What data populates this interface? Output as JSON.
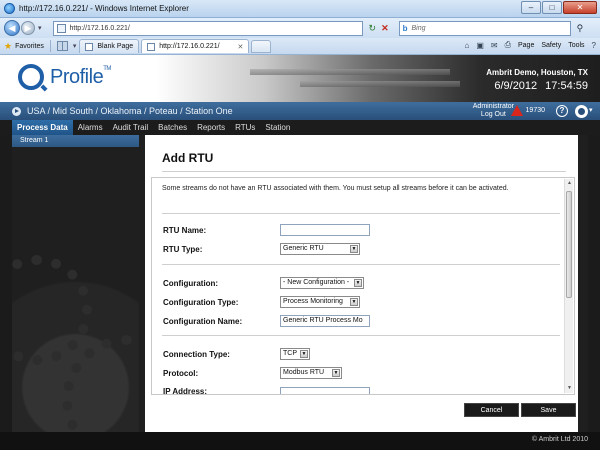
{
  "browser": {
    "title": "http://172.16.0.221/ - Windows Internet Explorer",
    "url": "http://172.16.0.221/",
    "search_placeholder": "Bing",
    "favorites_label": "Favorites",
    "tabs": [
      {
        "label": "Blank Page"
      },
      {
        "label": "http://172.16.0.221/"
      }
    ],
    "commands": [
      "Page",
      "Safety",
      "Tools"
    ]
  },
  "header": {
    "logo_text": "Profile",
    "logo_tm": "TM",
    "site": "Ambrit Demo, Houston, TX",
    "date": "6/9/2012",
    "time": "17:54:59"
  },
  "breadcrumb": "USA / Mid South / Oklahoma / Poteau / Station One",
  "user": {
    "line1": "Administrator",
    "line2": "Log Out"
  },
  "alert_count": "19730",
  "nav": [
    "Process Data",
    "Alarms",
    "Audit Trail",
    "Batches",
    "Reports",
    "RTUs",
    "Station"
  ],
  "sidebar": {
    "items": [
      "Stream 1"
    ]
  },
  "form": {
    "title": "Add RTU",
    "notice": "Some streams do not have an RTU associated with them. You must setup all streams before it can be activated.",
    "rtu_name_label": "RTU Name:",
    "rtu_name_value": "",
    "rtu_type_label": "RTU Type:",
    "rtu_type_value": "Generic RTU",
    "configuration_label": "Configuration:",
    "configuration_value": "- New Configuration -",
    "configuration_type_label": "Configuration Type:",
    "configuration_type_value": "Process Monitoring",
    "configuration_name_label": "Configuration Name:",
    "configuration_name_value": "Generic RTU Process Mo",
    "connection_type_label": "Connection Type:",
    "connection_type_value": "TCP",
    "protocol_label": "Protocol:",
    "protocol_value": "Modbus RTU",
    "ip_address_label": "IP Address:",
    "cancel_label": "Cancel",
    "save_label": "Save"
  },
  "footer": {
    "copyright": "© Ambrit Ltd 2010"
  }
}
